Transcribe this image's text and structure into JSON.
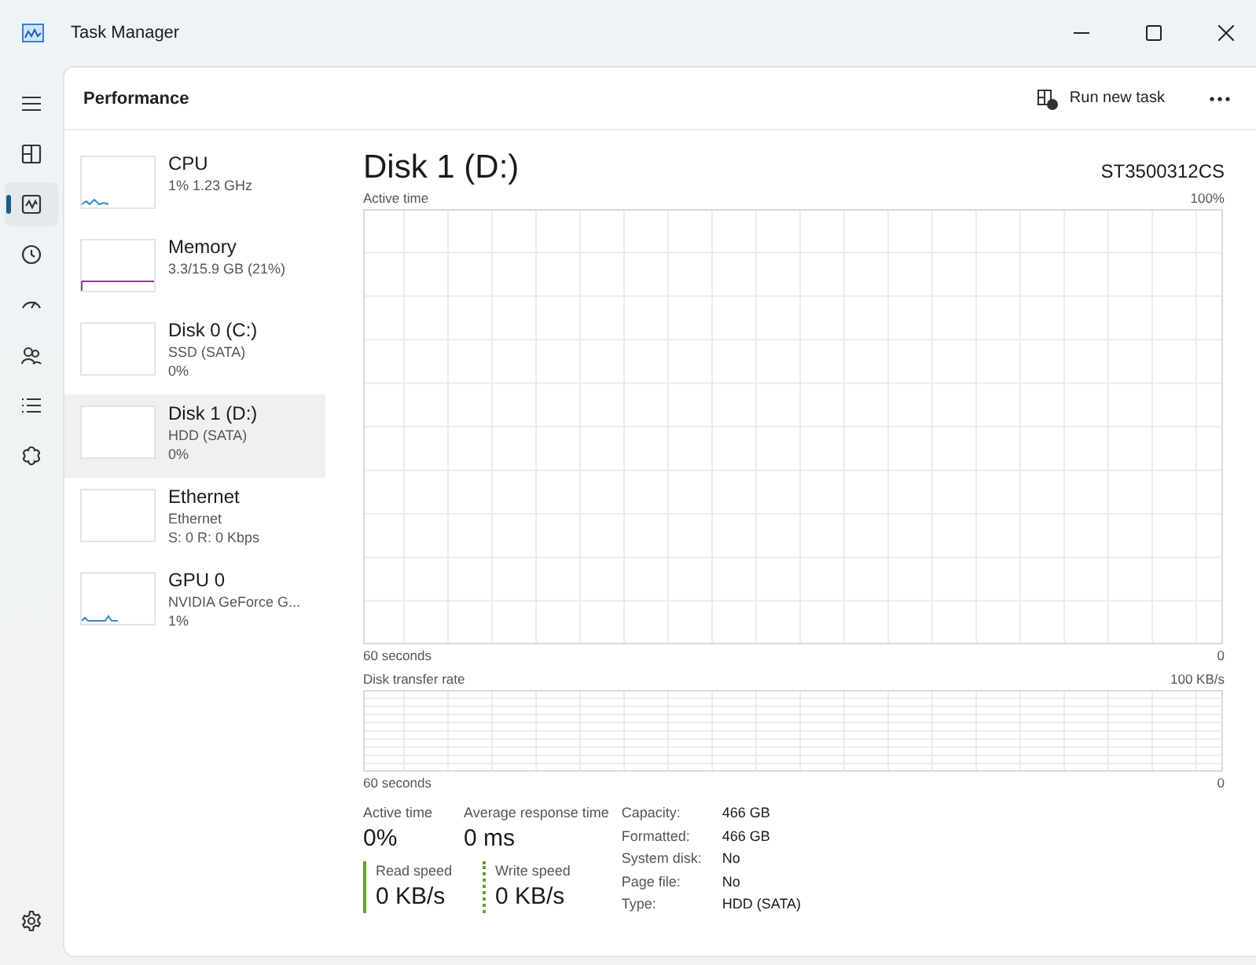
{
  "window": {
    "title": "Task Manager"
  },
  "nav_items": [
    {
      "selected": false
    },
    {
      "selected": false
    },
    {
      "selected": true
    },
    {
      "selected": false
    },
    {
      "selected": false
    },
    {
      "selected": false
    },
    {
      "selected": false
    },
    {
      "selected": false
    }
  ],
  "header": {
    "title": "Performance",
    "run_new_task": "Run new task"
  },
  "devices": [
    {
      "name": "CPU",
      "lines": [
        "1% 1.23 GHz"
      ],
      "selected": false
    },
    {
      "name": "Memory",
      "lines": [
        "3.3/15.9 GB (21%)"
      ],
      "selected": false
    },
    {
      "name": "Disk 0 (C:)",
      "lines": [
        "SSD (SATA)",
        "0%"
      ],
      "selected": false
    },
    {
      "name": "Disk 1 (D:)",
      "lines": [
        "HDD (SATA)",
        "0%"
      ],
      "selected": true
    },
    {
      "name": "Ethernet",
      "lines": [
        "Ethernet",
        "S: 0 R: 0 Kbps"
      ],
      "selected": false
    },
    {
      "name": "GPU 0",
      "lines": [
        "NVIDIA GeForce G...",
        "1%"
      ],
      "selected": false
    }
  ],
  "detail": {
    "title": "Disk 1 (D:)",
    "model": "ST3500312CS",
    "active_chart": {
      "label": "Active time",
      "max": "100%",
      "span": "60 seconds",
      "min": "0"
    },
    "transfer_chart": {
      "label": "Disk transfer rate",
      "max": "100 KB/s",
      "span": "60 seconds",
      "min": "0"
    },
    "stats": [
      {
        "label": "Active time",
        "value": "0%"
      },
      {
        "label": "Average response time",
        "value": "0 ms"
      }
    ],
    "speeds": [
      {
        "kind": "read",
        "label": "Read speed",
        "value": "0 KB/s"
      },
      {
        "kind": "write",
        "label": "Write speed",
        "value": "0 KB/s"
      }
    ],
    "properties": [
      {
        "label": "Capacity:",
        "value": "466 GB"
      },
      {
        "label": "Formatted:",
        "value": "466 GB"
      },
      {
        "label": "System disk:",
        "value": "No"
      },
      {
        "label": "Page file:",
        "value": "No"
      },
      {
        "label": "Type:",
        "value": "HDD (SATA)"
      }
    ]
  }
}
